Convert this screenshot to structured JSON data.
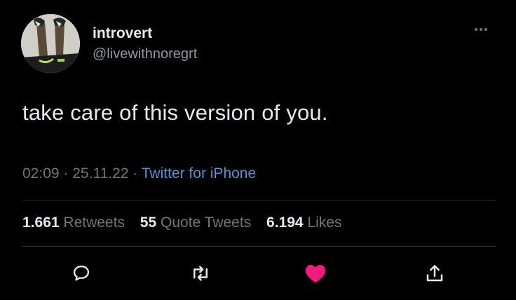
{
  "user": {
    "display_name": "introvert",
    "handle": "@livewithnoregrt"
  },
  "tweet": {
    "text": "take care of this version of you.",
    "time": "02:09",
    "date": "25.11.22",
    "separator": "·",
    "source": "Twitter for iPhone"
  },
  "stats": {
    "retweets_count": "1.661",
    "retweets_label": "Retweets",
    "quotes_count": "55",
    "quotes_label": "Quote Tweets",
    "likes_count": "6.194",
    "likes_label": "Likes"
  },
  "actions": [
    "reply-icon",
    "retweet-icon",
    "like-icon",
    "share-icon"
  ],
  "colors": {
    "background": "#000000",
    "source_link": "#4f94d9",
    "like_active": "#f91880",
    "muted": "#71767b"
  }
}
